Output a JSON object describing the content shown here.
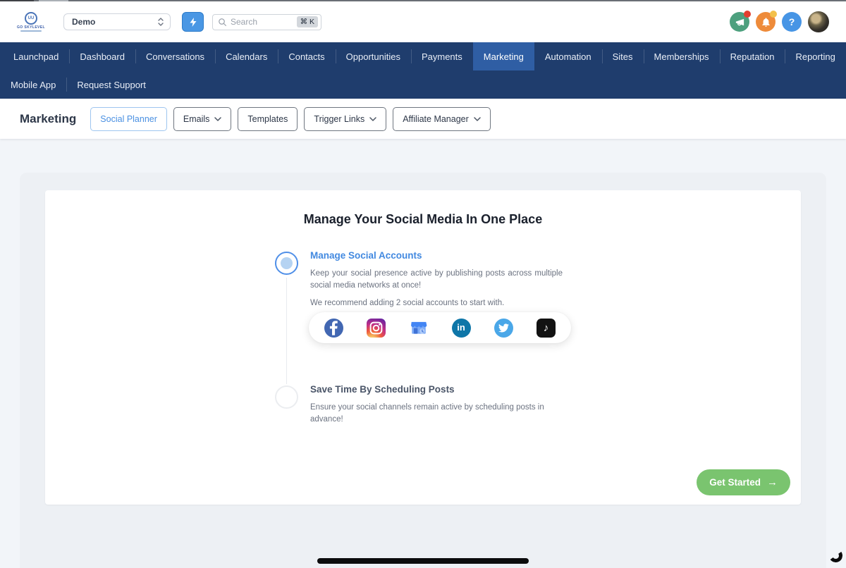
{
  "topbar": {
    "logo_brand": "GO SKYLEVEL",
    "logo_emblem_initials": "UU",
    "location_select": {
      "value": "Demo"
    },
    "search": {
      "placeholder": "Search",
      "shortcut": "⌘ K"
    },
    "help_label": "?"
  },
  "nav": {
    "row1": [
      {
        "label": "Launchpad"
      },
      {
        "label": "Dashboard"
      },
      {
        "label": "Conversations"
      },
      {
        "label": "Calendars"
      },
      {
        "label": "Contacts"
      },
      {
        "label": "Opportunities"
      },
      {
        "label": "Payments"
      },
      {
        "label": "Marketing",
        "active": true
      },
      {
        "label": "Automation"
      },
      {
        "label": "Sites"
      },
      {
        "label": "Memberships"
      },
      {
        "label": "Reputation"
      },
      {
        "label": "Reporting"
      }
    ],
    "row2": [
      {
        "label": "Mobile App"
      },
      {
        "label": "Request Support"
      }
    ]
  },
  "toolbar": {
    "title": "Marketing",
    "tabs": [
      {
        "label": "Social Planner",
        "active": true
      },
      {
        "label": "Emails",
        "dropdown": true
      },
      {
        "label": "Templates"
      },
      {
        "label": "Trigger Links",
        "dropdown": true
      },
      {
        "label": "Affiliate Manager",
        "dropdown": true
      }
    ]
  },
  "onboarding": {
    "title": "Manage Your Social Media In One Place",
    "step1": {
      "title": "Manage Social Accounts",
      "description": "Keep your social presence active by publishing posts across multiple social media networks at once!",
      "note": "We recommend adding 2 social accounts to start with."
    },
    "step2": {
      "title": "Save Time By Scheduling Posts",
      "description": "Ensure your social channels remain active by scheduling posts in advance!"
    },
    "social_networks": [
      "Facebook",
      "Instagram",
      "Google My Business",
      "LinkedIn",
      "Twitter",
      "TikTok"
    ],
    "cta_label": "Get Started",
    "cta_arrow": "→",
    "tiktok_glyph": "♪",
    "linkedin_glyph": "in"
  },
  "colors": {
    "nav_bg": "#1f3d6d",
    "nav_active_bg": "#2f5ea4",
    "accent_blue": "#4289e0",
    "cta_green": "#7ac46f",
    "page_bg": "#f2f5f9"
  }
}
